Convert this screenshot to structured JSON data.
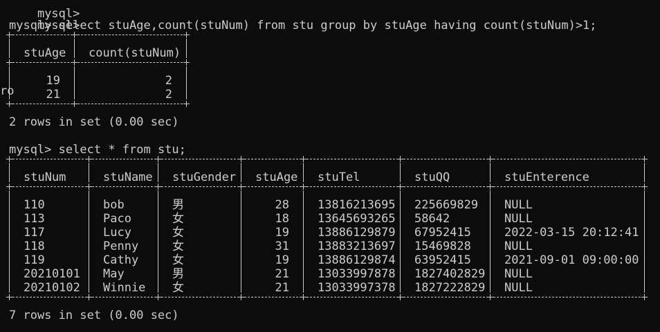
{
  "prompt": "mysql>",
  "lines_top": [
    "mysql>",
    "mysql>"
  ],
  "query1": "select stuAge,count(stuNum) from stu group by stuAge having count(stuNum)>1;",
  "edge_fragment": "ro",
  "result1": {
    "columns": [
      "stuAge",
      "count(stuNum)"
    ],
    "rows": [
      [
        "19",
        "2"
      ],
      [
        "21",
        "2"
      ]
    ],
    "summary": "2 rows in set (0.00 sec)"
  },
  "query2": "select * from stu;",
  "result2": {
    "columns": [
      "stuNum",
      "stuName",
      "stuGender",
      "stuAge",
      "stuTel",
      "stuQQ",
      "stuEnterence"
    ],
    "rows": [
      [
        "110",
        "bob",
        "男",
        "28",
        "13816213695",
        "225669829",
        "NULL"
      ],
      [
        "113",
        "Paco",
        "女",
        "18",
        "13645693265",
        "58642",
        "NULL"
      ],
      [
        "117",
        "Lucy",
        "女",
        "19",
        "13886129879",
        "67952415",
        "2022-03-15 20:12:41"
      ],
      [
        "118",
        "Penny",
        "女",
        "31",
        "13883213697",
        "15469828",
        "NULL"
      ],
      [
        "119",
        "Cathy",
        "女",
        "19",
        "13886129874",
        "63952415",
        "2021-09-01 09:00:00"
      ],
      [
        "20210101",
        "May",
        "男",
        "21",
        "13033997878",
        "1827402829",
        "NULL"
      ],
      [
        "20210102",
        "Winnie",
        "女",
        "21",
        "13033997378",
        "1827222829",
        "NULL"
      ]
    ],
    "summary": "7 rows in set (0.00 sec)"
  },
  "colors": {
    "background": "#0c0c0c",
    "text": "#cccccc"
  }
}
